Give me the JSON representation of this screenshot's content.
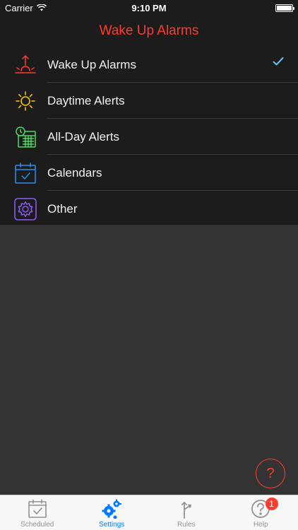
{
  "status_bar": {
    "carrier": "Carrier",
    "time": "9:10 PM"
  },
  "nav": {
    "title": "Wake Up Alarms"
  },
  "menu": {
    "items": [
      {
        "label": "Wake Up Alarms",
        "icon": "sunrise-icon",
        "color": "#ff3b30",
        "selected": true
      },
      {
        "label": "Daytime Alerts",
        "icon": "sun-icon",
        "color": "#ffcc00",
        "selected": false
      },
      {
        "label": "All-Day Alerts",
        "icon": "calendar-clock-icon",
        "color": "#4cd964",
        "selected": false
      },
      {
        "label": "Calendars",
        "icon": "calendar-check-icon",
        "color": "#2b8ef0",
        "selected": false
      },
      {
        "label": "Other",
        "icon": "gear-icon",
        "color": "#8e5cf6",
        "selected": false
      }
    ]
  },
  "fab": {
    "label": "?"
  },
  "tabs": {
    "items": [
      {
        "label": "Scheduled",
        "icon": "calendar-check-icon",
        "active": false
      },
      {
        "label": "Settings",
        "icon": "gears-icon",
        "active": true
      },
      {
        "label": "Rules",
        "icon": "signpost-icon",
        "active": false
      },
      {
        "label": "Help",
        "icon": "question-circle-icon",
        "active": false,
        "badge": "1"
      }
    ]
  },
  "colors": {
    "accent_red": "#ff3b30",
    "tab_active": "#007aff",
    "check_blue": "#5ac8fa"
  }
}
